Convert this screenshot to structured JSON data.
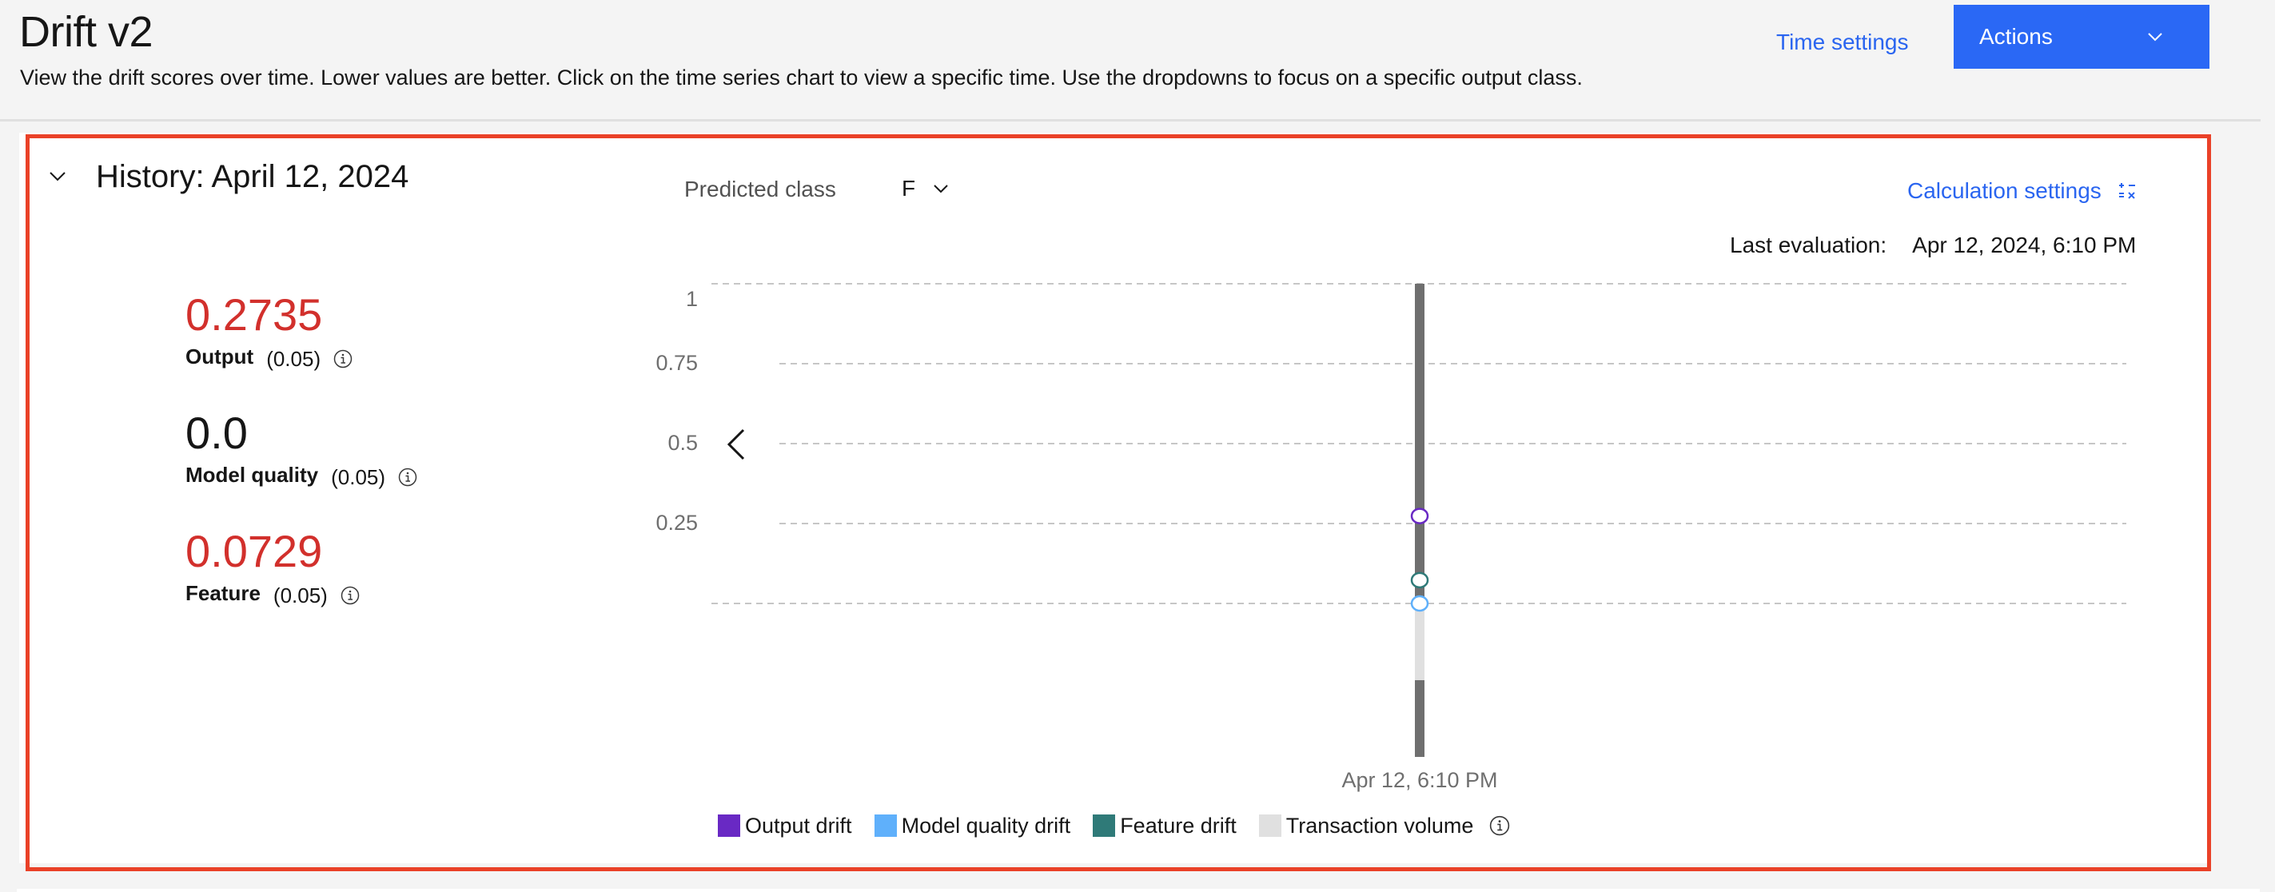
{
  "header": {
    "title": "Drift v2",
    "description": "View the drift scores over time. Lower values are better. Click on the time series chart to view a specific time. Use the dropdowns to focus on a specific output class.",
    "time_settings_label": "Time settings",
    "actions_label": "Actions"
  },
  "panel": {
    "title": "History: April 12, 2024",
    "metrics": [
      {
        "value": "0.2735",
        "name": "Output",
        "threshold": "(0.05)",
        "status": "alert"
      },
      {
        "value": "0.0",
        "name": "Model quality",
        "threshold": "(0.05)",
        "status": "ok"
      },
      {
        "value": "0.0729",
        "name": "Feature",
        "threshold": "(0.05)",
        "status": "alert"
      }
    ],
    "predicted_class_label": "Predicted class",
    "predicted_class_value": "F",
    "calculation_settings_label": "Calculation settings",
    "last_evaluation_label": "Last evaluation:",
    "last_evaluation_value": "Apr 12, 2024, 6:10 PM"
  },
  "colors": {
    "accent": "#2a65f0",
    "alert": "#d2302c",
    "highlight_border": "#ea4128",
    "output_drift": "#6929c4",
    "model_quality_drift": "#5fb0fb",
    "feature_drift": "#2f7a78",
    "transaction_volume": "#e0e0e0",
    "selection_bar": "#6f6f6f"
  },
  "chart_data": {
    "type": "scatter",
    "title": "",
    "xlabel": "",
    "ylabel": "",
    "ylim": [
      0,
      1
    ],
    "y_ticks": [
      "1",
      "0.75",
      "0.5",
      "0.25"
    ],
    "y_tick_values": [
      1,
      0.75,
      0.5,
      0.25
    ],
    "grid": true,
    "x": [
      "Apr 12, 6:10 PM"
    ],
    "selected_x": "Apr 12, 6:10 PM",
    "series": [
      {
        "name": "Output drift",
        "key": "output_drift",
        "values": [
          0.2735
        ]
      },
      {
        "name": "Model quality drift",
        "key": "model_quality_drift",
        "values": [
          0.0
        ]
      },
      {
        "name": "Feature drift",
        "key": "feature_drift",
        "values": [
          0.0729
        ]
      }
    ],
    "transaction_volume": {
      "name": "Transaction volume",
      "values_fraction_of_max": [
        0.5
      ]
    },
    "legend": [
      "Output drift",
      "Model quality drift",
      "Feature drift",
      "Transaction volume"
    ],
    "legend_position": "bottom"
  }
}
